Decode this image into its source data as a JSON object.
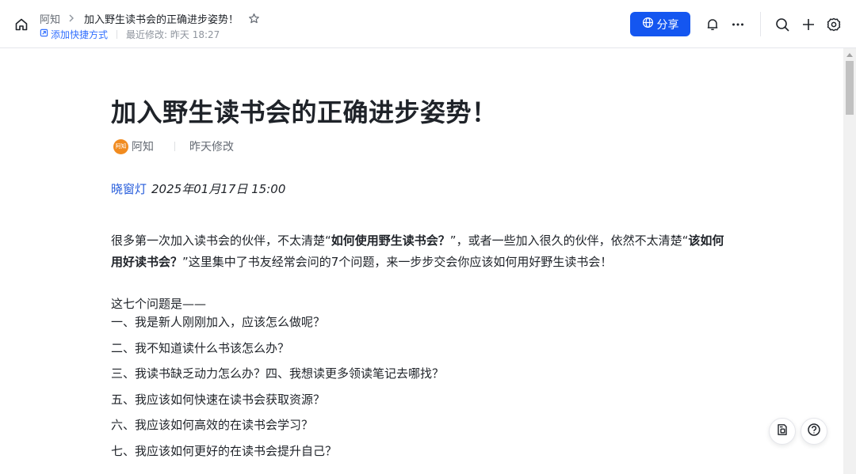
{
  "header": {
    "breadcrumb_root": "阿知",
    "doc_title": "加入野生读书会的正确进步姿势！",
    "shortcut_label": "添加快捷方式",
    "last_modified": "最近修改: 昨天 18:27",
    "share_label": "分享"
  },
  "document": {
    "title": "加入野生读书会的正确进步姿势！",
    "author": "阿知",
    "avatar_text": "阿知",
    "modified_label": "昨天修改",
    "byline_name": "晓窗灯",
    "byline_date": "2025年01月17日 15:00",
    "intro": {
      "p1": "很多第一次加入读书会的伙伴，不太清楚“",
      "b1": "如何使用野生读书会？",
      "p2": "”，或者一些加入很久的伙伴，依然不太清楚“",
      "b2": "该如何用好读书会？",
      "p3": "”这里集中了书友经常会问的7个问题，来一步步交会你应该如何用好野生读书会！"
    },
    "questions_heading": "这七个问题是——",
    "questions": [
      "一、我是新人刚刚加入，应该怎么做呢？",
      "二、我不知道读什么书该怎么办？",
      "三、我读书缺乏动力怎么办？四、我想读更多领读笔记去哪找？",
      "五、我应该如何快速在读书会获取资源？",
      "六、我应该如何高效的在读书会学习？",
      "七、我应该如何更好的在读书会提升自己？"
    ]
  },
  "colors": {
    "accent": "#1456f0",
    "link": "#3370ff",
    "avatar": "#f18b1f"
  }
}
